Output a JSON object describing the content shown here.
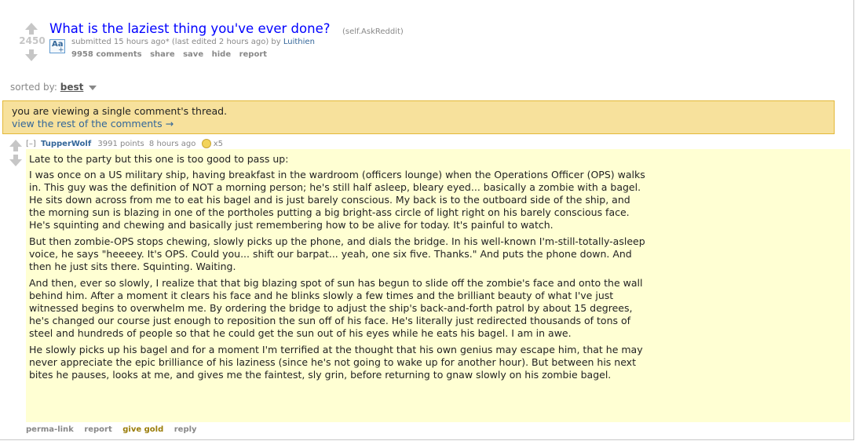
{
  "post": {
    "score": "2450",
    "title": "What is the laziest thing you've ever done?",
    "domain": "(self.AskReddit)",
    "thumbnail_text": "Aa",
    "thumbnail_plus": "+",
    "tagline_prefix": "submitted 15 hours ago* (last edited 2 hours ago) by",
    "author": "Luithien",
    "buttons": [
      "9958 comments",
      "share",
      "save",
      "hide",
      "report"
    ]
  },
  "sort": {
    "label": "sorted by:",
    "selected": "best"
  },
  "notice": {
    "line1": "you are viewing a single comment's thread.",
    "link": "view the rest of the comments →"
  },
  "comment": {
    "collapse": "[–]",
    "author": "TupperWolf",
    "points": "3991 points",
    "time": "8 hours ago",
    "gilded_count": "x5",
    "lead": "Late to the party but this one is too good to pass up:",
    "paragraphs": [
      "I was once on a US military ship, having breakfast in the wardroom (officers lounge) when the Operations Officer (OPS) walks in. This guy was the definition of NOT a morning person; he's still half asleep, bleary eyed... basically a zombie with a bagel. He sits down across from me to eat his bagel and is just barely conscious. My back is to the outboard side of the ship, and the morning sun is blazing in one of the portholes putting a big bright-ass circle of light right on his barely conscious face. He's squinting and chewing and basically just remembering how to be alive for today. It's painful to watch.",
      "But then zombie-OPS stops chewing, slowly picks up the phone, and dials the bridge. In his well-known I'm-still-totally-asleep voice, he says \"heeeey. It's OPS. Could you... shift our barpat... yeah, one six five. Thanks.\" And puts the phone down. And then he just sits there. Squinting. Waiting.",
      "And then, ever so slowly, I realize that that big blazing spot of sun has begun to slide off the zombie's face and onto the wall behind him. After a moment it clears his face and he blinks slowly a few times and the brilliant beauty of what I've just witnessed begins to overwhelm me. By ordering the bridge to adjust the ship's back-and-forth patrol by about 15 degrees, he's changed our course just enough to reposition the sun off of his face. He's literally just redirected thousands of tons of steel and hundreds of people so that he could get the sun out of his eyes while he eats his bagel. I am in awe.",
      "He slowly picks up his bagel and for a moment I'm terrified at the thought that his own genius may escape him, that he may never appreciate the epic brilliance of his laziness (since he's not going to wake up for another hour). But between his next bites he pauses, looks at me, and gives me the faintest, sly grin, before returning to gnaw slowly on his zombie bagel."
    ],
    "buttons": [
      "perma-link",
      "report",
      "give gold",
      "reply"
    ]
  }
}
